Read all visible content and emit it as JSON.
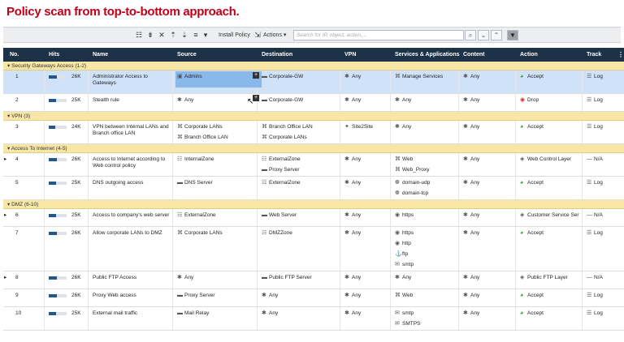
{
  "title": "Policy scan from top-to-bottom approach.",
  "toolbar": {
    "install_policy": "Install Policy",
    "actions": "Actions ▾",
    "search_placeholder": "Search for IP, object, action,..."
  },
  "columns": {
    "no": "No.",
    "hits": "Hits",
    "name": "Name",
    "source": "Source",
    "destination": "Destination",
    "vpn": "VPN",
    "services": "Services & Applications",
    "content": "Content",
    "action": "Action",
    "track": "Track"
  },
  "sections": [
    {
      "label": "Security Gateways Access (1-2)",
      "rows": [
        {
          "no": "1",
          "hits": "26K",
          "hits_level": 0.45,
          "name": [
            "Administrator Access to",
            "Gateways"
          ],
          "source": [
            [
              "user-group-icon",
              "Admins"
            ]
          ],
          "destination": [
            [
              "gateway-icon",
              "Corporate-GW"
            ]
          ],
          "vpn": [
            [
              "any-icon",
              "Any"
            ]
          ],
          "services": [
            [
              "service-group-icon",
              "Manage Services"
            ]
          ],
          "content": "Any",
          "action": [
            "accept-icon",
            "Accept"
          ],
          "track": "Log",
          "selected": true
        },
        {
          "no": "2",
          "hits": "25K",
          "hits_level": 0.4,
          "name": [
            "Stealth rule"
          ],
          "source": [
            [
              "any-icon",
              "Any"
            ]
          ],
          "destination": [
            [
              "gateway-icon",
              "Corporate-GW"
            ]
          ],
          "vpn": [
            [
              "any-icon",
              "Any"
            ]
          ],
          "services": [
            [
              "any-icon",
              "Any"
            ]
          ],
          "content": "Any",
          "action": [
            "drop-icon",
            "Drop"
          ],
          "track": "Log"
        }
      ]
    },
    {
      "label": "VPN (3)",
      "rows": [
        {
          "no": "3",
          "hits": "24K",
          "hits_level": 0.35,
          "name": [
            "VPN between Internal LANs and",
            "Branch office LAN"
          ],
          "source": [
            [
              "network-group-icon",
              "Corporate LANs"
            ],
            [
              "network-group-icon",
              "Branch Office LAN"
            ]
          ],
          "destination": [
            [
              "network-group-icon",
              "Branch Office LAN"
            ],
            [
              "network-group-icon",
              "Corporate LANs"
            ]
          ],
          "vpn": [
            [
              "vpn-community-icon",
              "Site2Site"
            ]
          ],
          "services": [
            [
              "any-icon",
              "Any"
            ]
          ],
          "content": "Any",
          "action": [
            "accept-icon",
            "Accept"
          ],
          "track": "Log"
        }
      ]
    },
    {
      "label": "Access To Internet (4-5)",
      "rows": [
        {
          "no": "4",
          "hits": "26K",
          "hits_level": 0.45,
          "expand": true,
          "name": [
            "Access to Internet according to",
            "Web control policy"
          ],
          "source": [
            [
              "zone-icon",
              "InternalZone"
            ]
          ],
          "destination": [
            [
              "zone-icon",
              "ExternalZone"
            ],
            [
              "host-icon",
              "Proxy Server"
            ]
          ],
          "vpn": [
            [
              "any-icon",
              "Any"
            ]
          ],
          "services": [
            [
              "service-group-icon",
              "Web"
            ],
            [
              "service-group-icon",
              "Web_Proxy"
            ]
          ],
          "content": "Any",
          "action": [
            "layer-icon",
            "Web Control Layer"
          ],
          "track": "N/A"
        },
        {
          "no": "5",
          "hits": "25K",
          "hits_level": 0.4,
          "name": [
            "DNS outgoing access"
          ],
          "source": [
            [
              "host-icon",
              "DNS Server"
            ]
          ],
          "destination": [
            [
              "zone-icon",
              "ExternalZone"
            ]
          ],
          "vpn": [
            [
              "any-icon",
              "Any"
            ]
          ],
          "services": [
            [
              "udp-service-icon",
              "domain-udp"
            ],
            [
              "tcp-service-icon",
              "domain-tcp"
            ]
          ],
          "content": "Any",
          "action": [
            "accept-icon",
            "Accept"
          ],
          "track": "Log"
        }
      ]
    },
    {
      "label": "DMZ (6-10)",
      "rows": [
        {
          "no": "6",
          "hits": "25K",
          "hits_level": 0.4,
          "expand": true,
          "name": [
            "Access to company's web server"
          ],
          "source": [
            [
              "zone-icon",
              "ExternalZone"
            ]
          ],
          "destination": [
            [
              "host-icon",
              "Web Server"
            ]
          ],
          "vpn": [
            [
              "any-icon",
              "Any"
            ]
          ],
          "services": [
            [
              "https-service-icon",
              "https"
            ]
          ],
          "content": "Any",
          "action": [
            "layer-icon",
            "Customer Service Ser"
          ],
          "track": "N/A"
        },
        {
          "no": "7",
          "hits": "26K",
          "hits_level": 0.45,
          "name": [
            "Allow corporate LANs to DMZ"
          ],
          "source": [
            [
              "network-group-icon",
              "Corporate LANs"
            ]
          ],
          "destination": [
            [
              "zone-icon",
              "DMZZone"
            ]
          ],
          "vpn": [
            [
              "any-icon",
              "Any"
            ]
          ],
          "services": [
            [
              "https-service-icon",
              "https"
            ],
            [
              "http-service-icon",
              "http"
            ],
            [
              "ftp-service-icon",
              "ftp"
            ],
            [
              "smtp-service-icon",
              "smtp"
            ]
          ],
          "content": "Any",
          "action": [
            "accept-icon",
            "Accept"
          ],
          "track": "Log"
        },
        {
          "no": "8",
          "hits": "26K",
          "hits_level": 0.45,
          "expand": true,
          "name": [
            "Public FTP Access"
          ],
          "source": [
            [
              "any-icon",
              "Any"
            ]
          ],
          "destination": [
            [
              "host-icon",
              "Public FTP Server"
            ]
          ],
          "vpn": [
            [
              "any-icon",
              "Any"
            ]
          ],
          "services": [
            [
              "any-icon",
              "Any"
            ]
          ],
          "content": "Any",
          "action": [
            "layer-icon",
            "Public FTP Layer"
          ],
          "track": "N/A"
        },
        {
          "no": "9",
          "hits": "26K",
          "hits_level": 0.45,
          "name": [
            "Proxy Web access"
          ],
          "source": [
            [
              "host-icon",
              "Proxy Server"
            ]
          ],
          "destination": [
            [
              "any-icon",
              "Any"
            ]
          ],
          "vpn": [
            [
              "any-icon",
              "Any"
            ]
          ],
          "services": [
            [
              "service-group-icon",
              "Web"
            ]
          ],
          "content": "Any",
          "action": [
            "accept-icon",
            "Accept"
          ],
          "track": "Log"
        },
        {
          "no": "10",
          "hits": "25K",
          "hits_level": 0.4,
          "name": [
            "External mail traffic"
          ],
          "source": [
            [
              "host-icon",
              "Mail Relay"
            ]
          ],
          "destination": [
            [
              "any-icon",
              "Any"
            ]
          ],
          "vpn": [
            [
              "any-icon",
              "Any"
            ]
          ],
          "services": [
            [
              "smtp-service-icon",
              "smtp"
            ],
            [
              "smtps-service-icon",
              "SMTPS"
            ]
          ],
          "content": "Any",
          "action": [
            "accept-icon",
            "Accept"
          ],
          "track": "Log"
        }
      ]
    }
  ],
  "colors": {
    "header_bg": "#1d3147",
    "section_bg": "#f7e6a6",
    "selected_row": "#cfe2f8",
    "accept": "#2a9a3a",
    "drop": "#d22b2b",
    "title": "#c0001a"
  }
}
